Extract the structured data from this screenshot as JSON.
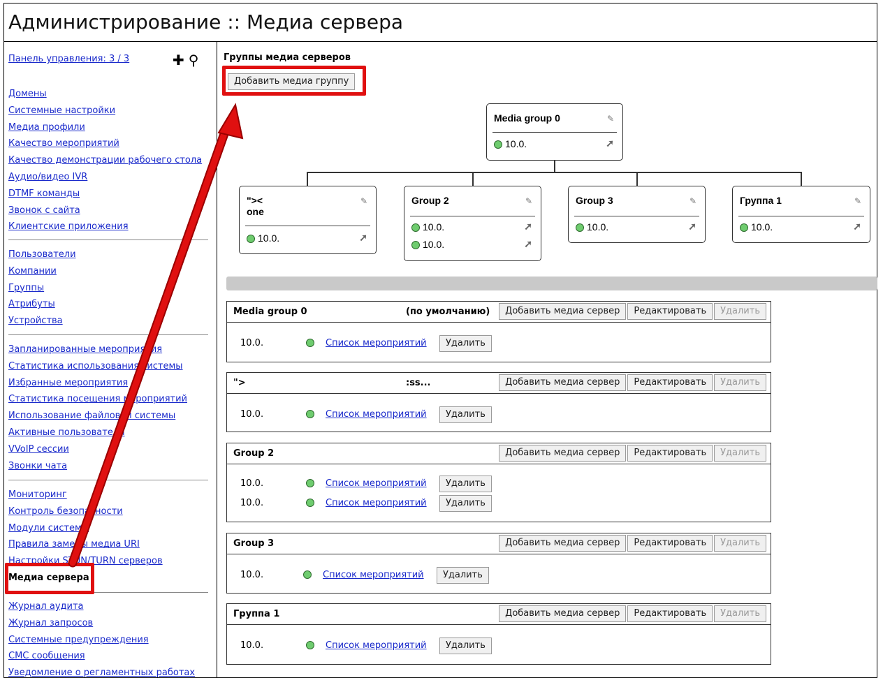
{
  "page": {
    "title": "Администрирование :: Медиа сервера"
  },
  "sidebar": {
    "panel_link": "Панель управления: 3 / 3",
    "add_icon": "plus-icon",
    "search_icon": "search-icon",
    "group1": [
      "Домены",
      "Системные настройки",
      "Медиа профили",
      "Качество мероприятий",
      "Качество демонстрации рабочего стола",
      "Аудио/видео IVR",
      "DTMF команды",
      "Звонок с сайта",
      "Клиентские приложения"
    ],
    "group2": [
      "Пользователи",
      "Компании",
      "Группы",
      "Атрибуты",
      "Устройства"
    ],
    "group3": [
      "Запланированные мероприятия",
      "Статистика использования системы",
      "Избранные мероприятия",
      "Статистика посещения мероприятий",
      "Использование файловой системы",
      "Активные пользователи",
      "VVoIP сессии",
      "Звонки чата"
    ],
    "group4": [
      "Мониторинг",
      "Контроль безопасности",
      "Модули системы",
      "Правила замены медиа URI",
      "Настройки STUN/TURN серверов",
      "Медиа сервера"
    ],
    "group5": [
      "Журнал аудита",
      "Журнал запросов",
      "Системные предупреждения",
      "СМС сообщения",
      "Уведомление о регламентных работах"
    ]
  },
  "main": {
    "section_title": "Группы медиа серверов",
    "add_group_button": "Добавить медиа группу",
    "tree": {
      "root": {
        "title": "Media group 0",
        "servers": [
          "10.0."
        ]
      },
      "children": [
        {
          "title": "\"><\none",
          "servers": [
            "10.0."
          ]
        },
        {
          "title": "Group 2",
          "servers": [
            "10.0.",
            "10.0."
          ]
        },
        {
          "title": "Group 3",
          "servers": [
            "10.0."
          ]
        },
        {
          "title": "Группа 1",
          "servers": [
            "10.0."
          ]
        }
      ]
    },
    "groups": [
      {
        "name": "Media group 0",
        "note": "(по умолчанию)",
        "servers": [
          "10.0."
        ]
      },
      {
        "name": "\">",
        "note": ":ss...",
        "servers": [
          "10.0."
        ]
      },
      {
        "name": "Group 2",
        "note": "",
        "servers": [
          "10.0.",
          "10.0."
        ]
      },
      {
        "name": "Group 3",
        "note": "",
        "servers": [
          "10.0."
        ]
      },
      {
        "name": "Группа 1",
        "note": "",
        "servers": [
          "10.0."
        ]
      }
    ],
    "buttons": {
      "add_server": "Добавить медиа сервер",
      "edit": "Редактировать",
      "delete": "Удалить",
      "events_list": "Список мероприятий",
      "delete_server": "Удалить"
    }
  },
  "colors": {
    "link": "#1a2acb",
    "highlight": "#e01010",
    "status_ok": "#6fcc6f"
  }
}
